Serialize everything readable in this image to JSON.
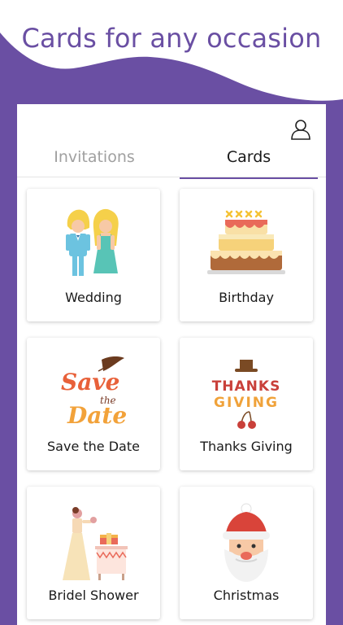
{
  "header": {
    "headline": "Cards for any occasion"
  },
  "colors": {
    "brand": "#6a4fa3",
    "background": "#ffffff",
    "inactive_tab": "#a0a0a0"
  },
  "tabs": [
    {
      "label": "Invitations",
      "active": false
    },
    {
      "label": "Cards",
      "active": true
    }
  ],
  "icons": {
    "profile": "person-icon"
  },
  "cards": [
    {
      "label": "Wedding",
      "icon": "wedding-couple-icon"
    },
    {
      "label": "Birthday",
      "icon": "birthday-cake-icon"
    },
    {
      "label": "Save the Date",
      "icon": "save-the-date-icon",
      "art_text": [
        "Save",
        "the",
        "Date"
      ]
    },
    {
      "label": "Thanks Giving",
      "icon": "thanksgiving-icon",
      "art_text": [
        "THANKS",
        "GIVING"
      ]
    },
    {
      "label": "Bridel Shower",
      "icon": "bridal-shower-icon"
    },
    {
      "label": "Christmas",
      "icon": "santa-icon"
    }
  ]
}
